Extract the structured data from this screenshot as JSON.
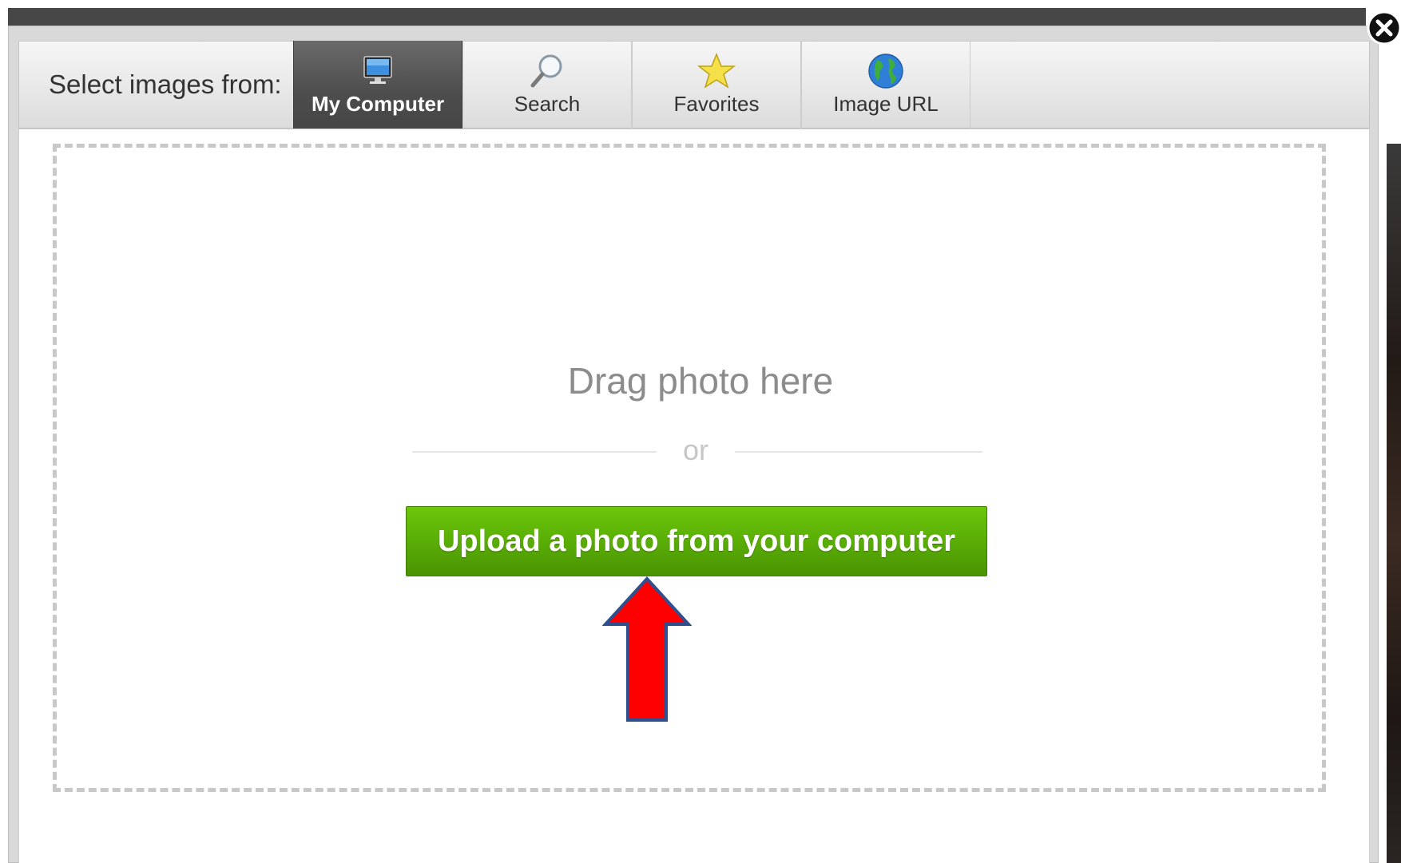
{
  "dialog": {
    "select_label": "Select images from:",
    "tabs": [
      {
        "label": "My Computer",
        "icon": "monitor-icon",
        "active": true
      },
      {
        "label": "Search",
        "icon": "magnifier-icon",
        "active": false
      },
      {
        "label": "Favorites",
        "icon": "star-icon",
        "active": false
      },
      {
        "label": "Image URL",
        "icon": "globe-icon",
        "active": false
      }
    ],
    "dropzone": {
      "drag_text": "Drag photo here",
      "or_text": "or",
      "upload_button_label": "Upload a photo from your computer"
    },
    "close_icon": "close-icon"
  },
  "annotation": {
    "icon": "red-arrow-up-icon",
    "color": "#ff0000",
    "outline": "#2f4f8f"
  },
  "colors": {
    "active_tab": "#4d4d4d",
    "upload_button": "#58ab06",
    "dropzone_border": "#c8c8c8"
  }
}
